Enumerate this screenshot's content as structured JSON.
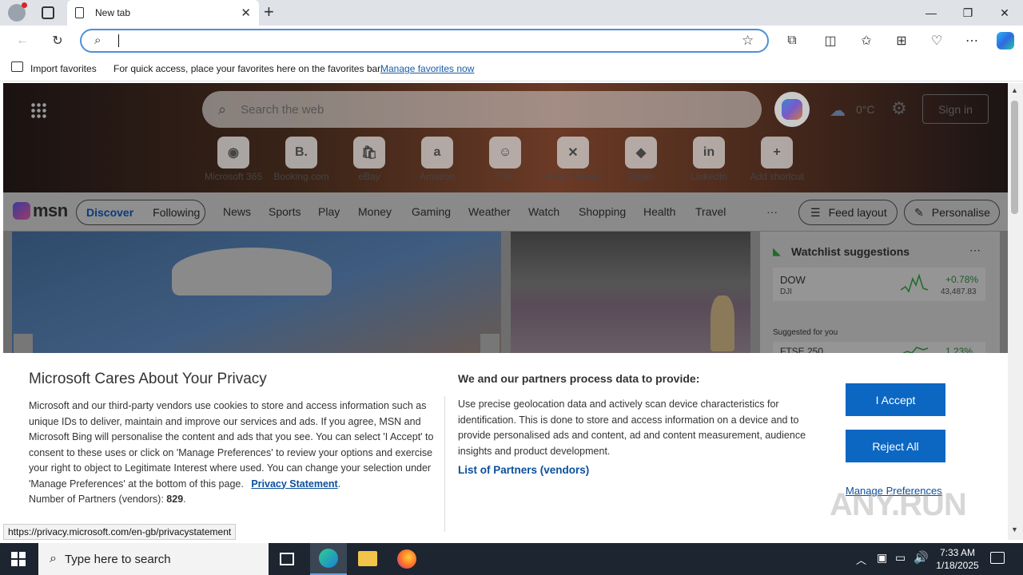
{
  "browser": {
    "tab_title": "New tab",
    "address_value": "",
    "favbar": {
      "import_label": "Import favorites",
      "hint": "For quick access, place your favorites here on the favorites bar.",
      "manage_link": "Manage favorites now"
    }
  },
  "msn": {
    "search_placeholder": "Search the web",
    "weather_temp": "0°C",
    "signin_label": "Sign in",
    "shortcuts": [
      {
        "label": "Microsoft 365",
        "glyph": "◉"
      },
      {
        "label": "Booking.com",
        "glyph": "B."
      },
      {
        "label": "eBay",
        "glyph": "🛍"
      },
      {
        "label": "Amazon",
        "glyph": "a"
      },
      {
        "label": "TUI",
        "glyph": "☺"
      },
      {
        "label": "Forty Thieves",
        "glyph": "✕"
      },
      {
        "label": "Deals",
        "glyph": "◆"
      },
      {
        "label": "LinkedIn",
        "glyph": "in"
      },
      {
        "label": "Add shortcut",
        "glyph": "+"
      }
    ],
    "logo": "msn",
    "tabs": [
      "Discover",
      "Following"
    ],
    "nav": [
      "News",
      "Sports",
      "Play",
      "Money",
      "Gaming",
      "Weather",
      "Watch",
      "Shopping",
      "Health",
      "Travel"
    ],
    "more_label": "···",
    "feed_layout_label": "Feed layout",
    "personalise_label": "Personalise",
    "watchlist": {
      "title": "Watchlist suggestions",
      "item": {
        "symbol": "DOW",
        "name": "DJI",
        "change": "+0.78%",
        "value": "43,487.83"
      },
      "suggested_label": "Suggested for you",
      "item2": {
        "symbol": "FTSE 250",
        "change": "1.23%"
      }
    }
  },
  "privacy": {
    "title": "Microsoft Cares About Your Privacy",
    "body": "Microsoft and our third-party vendors use cookies to store and access information such as unique IDs to deliver, maintain and improve our services and ads. If you agree, MSN and Microsoft Bing will personalise the content and ads that you see. You can select 'I Accept' to consent to these uses or click on 'Manage Preferences' to review your options and exercise your right to object to Legitimate Interest where used.  You can change your selection under 'Manage Preferences' at the bottom of this page.",
    "privacy_link": "Privacy Statement",
    "partners_label": "Number of Partners (vendors):",
    "partners_count": "829",
    "right_title": "We and our partners process data to provide:",
    "right_body": "Use precise geolocation data and actively scan device characteristics for identification. This is done to store and access information on a device and to provide personalised ads and content, ad and content measurement, audience insights and product development.",
    "partners_list_link": "List of Partners (vendors)",
    "accept_label": "I Accept",
    "reject_label": "Reject All",
    "manage_label": "Manage Preferences"
  },
  "status_url": "https://privacy.microsoft.com/en-gb/privacystatement",
  "taskbar": {
    "search_placeholder": "Type here to search",
    "time": "7:33 AM",
    "date": "1/18/2025"
  },
  "watermark": "ANY.RUN"
}
